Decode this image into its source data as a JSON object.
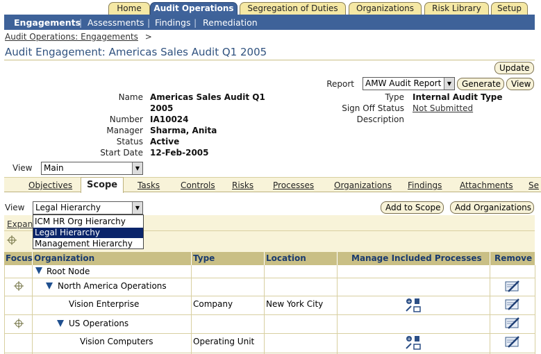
{
  "top_tabs": [
    {
      "label": "Home"
    },
    {
      "label": "Audit Operations"
    },
    {
      "label": "Segregation of Duties"
    },
    {
      "label": "Organizations"
    },
    {
      "label": "Risk Library"
    },
    {
      "label": "Setup"
    }
  ],
  "sub_nav": {
    "items": [
      "Engagements",
      "Assessments",
      "Findings",
      "Remediation"
    ],
    "separator": "|"
  },
  "breadcrumb": {
    "link": "Audit Operations: Engagements",
    "sep": ">"
  },
  "page_title": "Audit Engagement: Americas Sales Audit Q1 2005",
  "buttons": {
    "update": "Update",
    "generate": "Generate",
    "view": "View",
    "add_to_scope": "Add to Scope",
    "add_organizations": "Add Organizations"
  },
  "report": {
    "label": "Report",
    "value": "AMW Audit Report"
  },
  "details": {
    "name_label": "Name",
    "name_line1": "Americas Sales Audit Q1",
    "name_line2": "2005",
    "number_label": "Number",
    "number": "IA10024",
    "manager_label": "Manager",
    "manager": "Sharma, Anita",
    "status_label": "Status",
    "status": "Active",
    "start_label": "Start Date",
    "start": "12-Feb-2005",
    "type_label": "Type",
    "type": "Internal Audit Type",
    "signoff_label": "Sign Off Status",
    "signoff": "Not Submitted",
    "description_label": "Description"
  },
  "view_main": {
    "label": "View",
    "value": "Main"
  },
  "sub_tabs": [
    "Objectives",
    "Scope",
    "Tasks",
    "Controls",
    "Risks",
    "Processes",
    "Organizations",
    "Findings",
    "Attachments",
    "Se"
  ],
  "scope_view": {
    "label": "View",
    "value": "Legal Hierarchy",
    "options": [
      "ICM HR Org Hierarchy",
      "Legal Hierarchy",
      "Management Hierarchy"
    ]
  },
  "expand_link": "Expan",
  "table": {
    "headers": [
      "Focus",
      "Organization",
      "Type",
      "Location",
      "Manage Included Processes",
      "Remove"
    ],
    "rows": [
      {
        "org": "Root Node",
        "type": "",
        "location": ""
      },
      {
        "org": "North America Operations",
        "type": "",
        "location": ""
      },
      {
        "org": "Vision Enterprise",
        "type": "Company",
        "location": "New York City"
      },
      {
        "org": "US Operations",
        "type": "",
        "location": ""
      },
      {
        "org": "Vision Computers",
        "type": "Operating Unit",
        "location": ""
      }
    ]
  },
  "colors": {
    "brand_blue": "#3e6299",
    "tab_tan": "#f5e8a4",
    "header_tan": "#c9bf85",
    "title_blue": "#30527f"
  }
}
